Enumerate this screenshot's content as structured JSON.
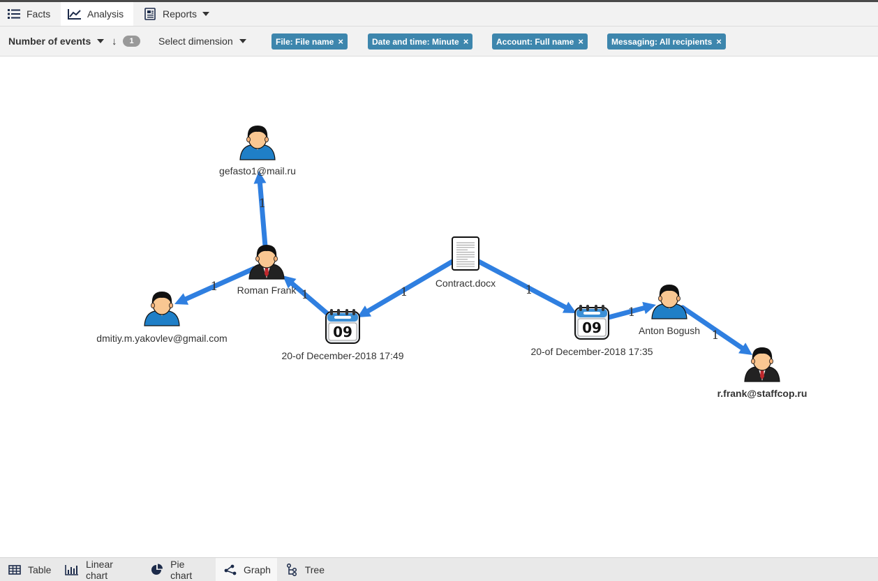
{
  "tabs": [
    {
      "label": "Facts",
      "icon": "list-icon"
    },
    {
      "label": "Analysis",
      "icon": "line-chart-icon",
      "active": true
    },
    {
      "label": "Reports",
      "icon": "report-icon"
    }
  ],
  "toolbar": {
    "measure": "Number of events",
    "sort_count": "1",
    "dimension_select": "Select dimension",
    "chips": [
      {
        "label": "File: File name"
      },
      {
        "label": "Date and time: Minute"
      },
      {
        "label": "Account: Full name"
      },
      {
        "label": "Messaging: All recipients"
      }
    ],
    "chip_remove": "×"
  },
  "graph": {
    "nodes": [
      {
        "id": "gefasto",
        "type": "user-casual",
        "label": "gefasto1@mail.ru"
      },
      {
        "id": "roman",
        "type": "user-suit",
        "label": "Roman Frank"
      },
      {
        "id": "dmitiy",
        "type": "user-casual",
        "label": "dmitiy.m.yakovlev@gmail.com"
      },
      {
        "id": "date1",
        "type": "calendar",
        "label": "20-of December-2018 17:49",
        "day": "09"
      },
      {
        "id": "contract",
        "type": "document",
        "label": "Contract.docx"
      },
      {
        "id": "date2",
        "type": "calendar",
        "label": "20-of December-2018 17:35",
        "day": "09"
      },
      {
        "id": "anton",
        "type": "user-casual",
        "label": "Anton Bogush"
      },
      {
        "id": "rfrank",
        "type": "user-suit",
        "label": "r.frank@staffcop.ru",
        "bold": true
      }
    ],
    "edges": [
      {
        "from": "contract",
        "to": "date1",
        "label": "1"
      },
      {
        "from": "date1",
        "to": "roman",
        "label": "1"
      },
      {
        "from": "roman",
        "to": "gefasto",
        "label": "1"
      },
      {
        "from": "roman",
        "to": "dmitiy",
        "label": "1"
      },
      {
        "from": "contract",
        "to": "date2",
        "label": "1"
      },
      {
        "from": "date2",
        "to": "anton",
        "label": "1"
      },
      {
        "from": "anton",
        "to": "rfrank",
        "label": "1"
      }
    ],
    "edge_color": "#2f7fe0"
  },
  "bottom_tabs": [
    {
      "label": "Table",
      "icon": "table-icon"
    },
    {
      "label": "Linear chart",
      "icon": "bar-chart-icon"
    },
    {
      "label": "Pie chart",
      "icon": "pie-chart-icon"
    },
    {
      "label": "Graph",
      "icon": "graph-icon",
      "active": true
    },
    {
      "label": "Tree",
      "icon": "tree-icon"
    }
  ]
}
